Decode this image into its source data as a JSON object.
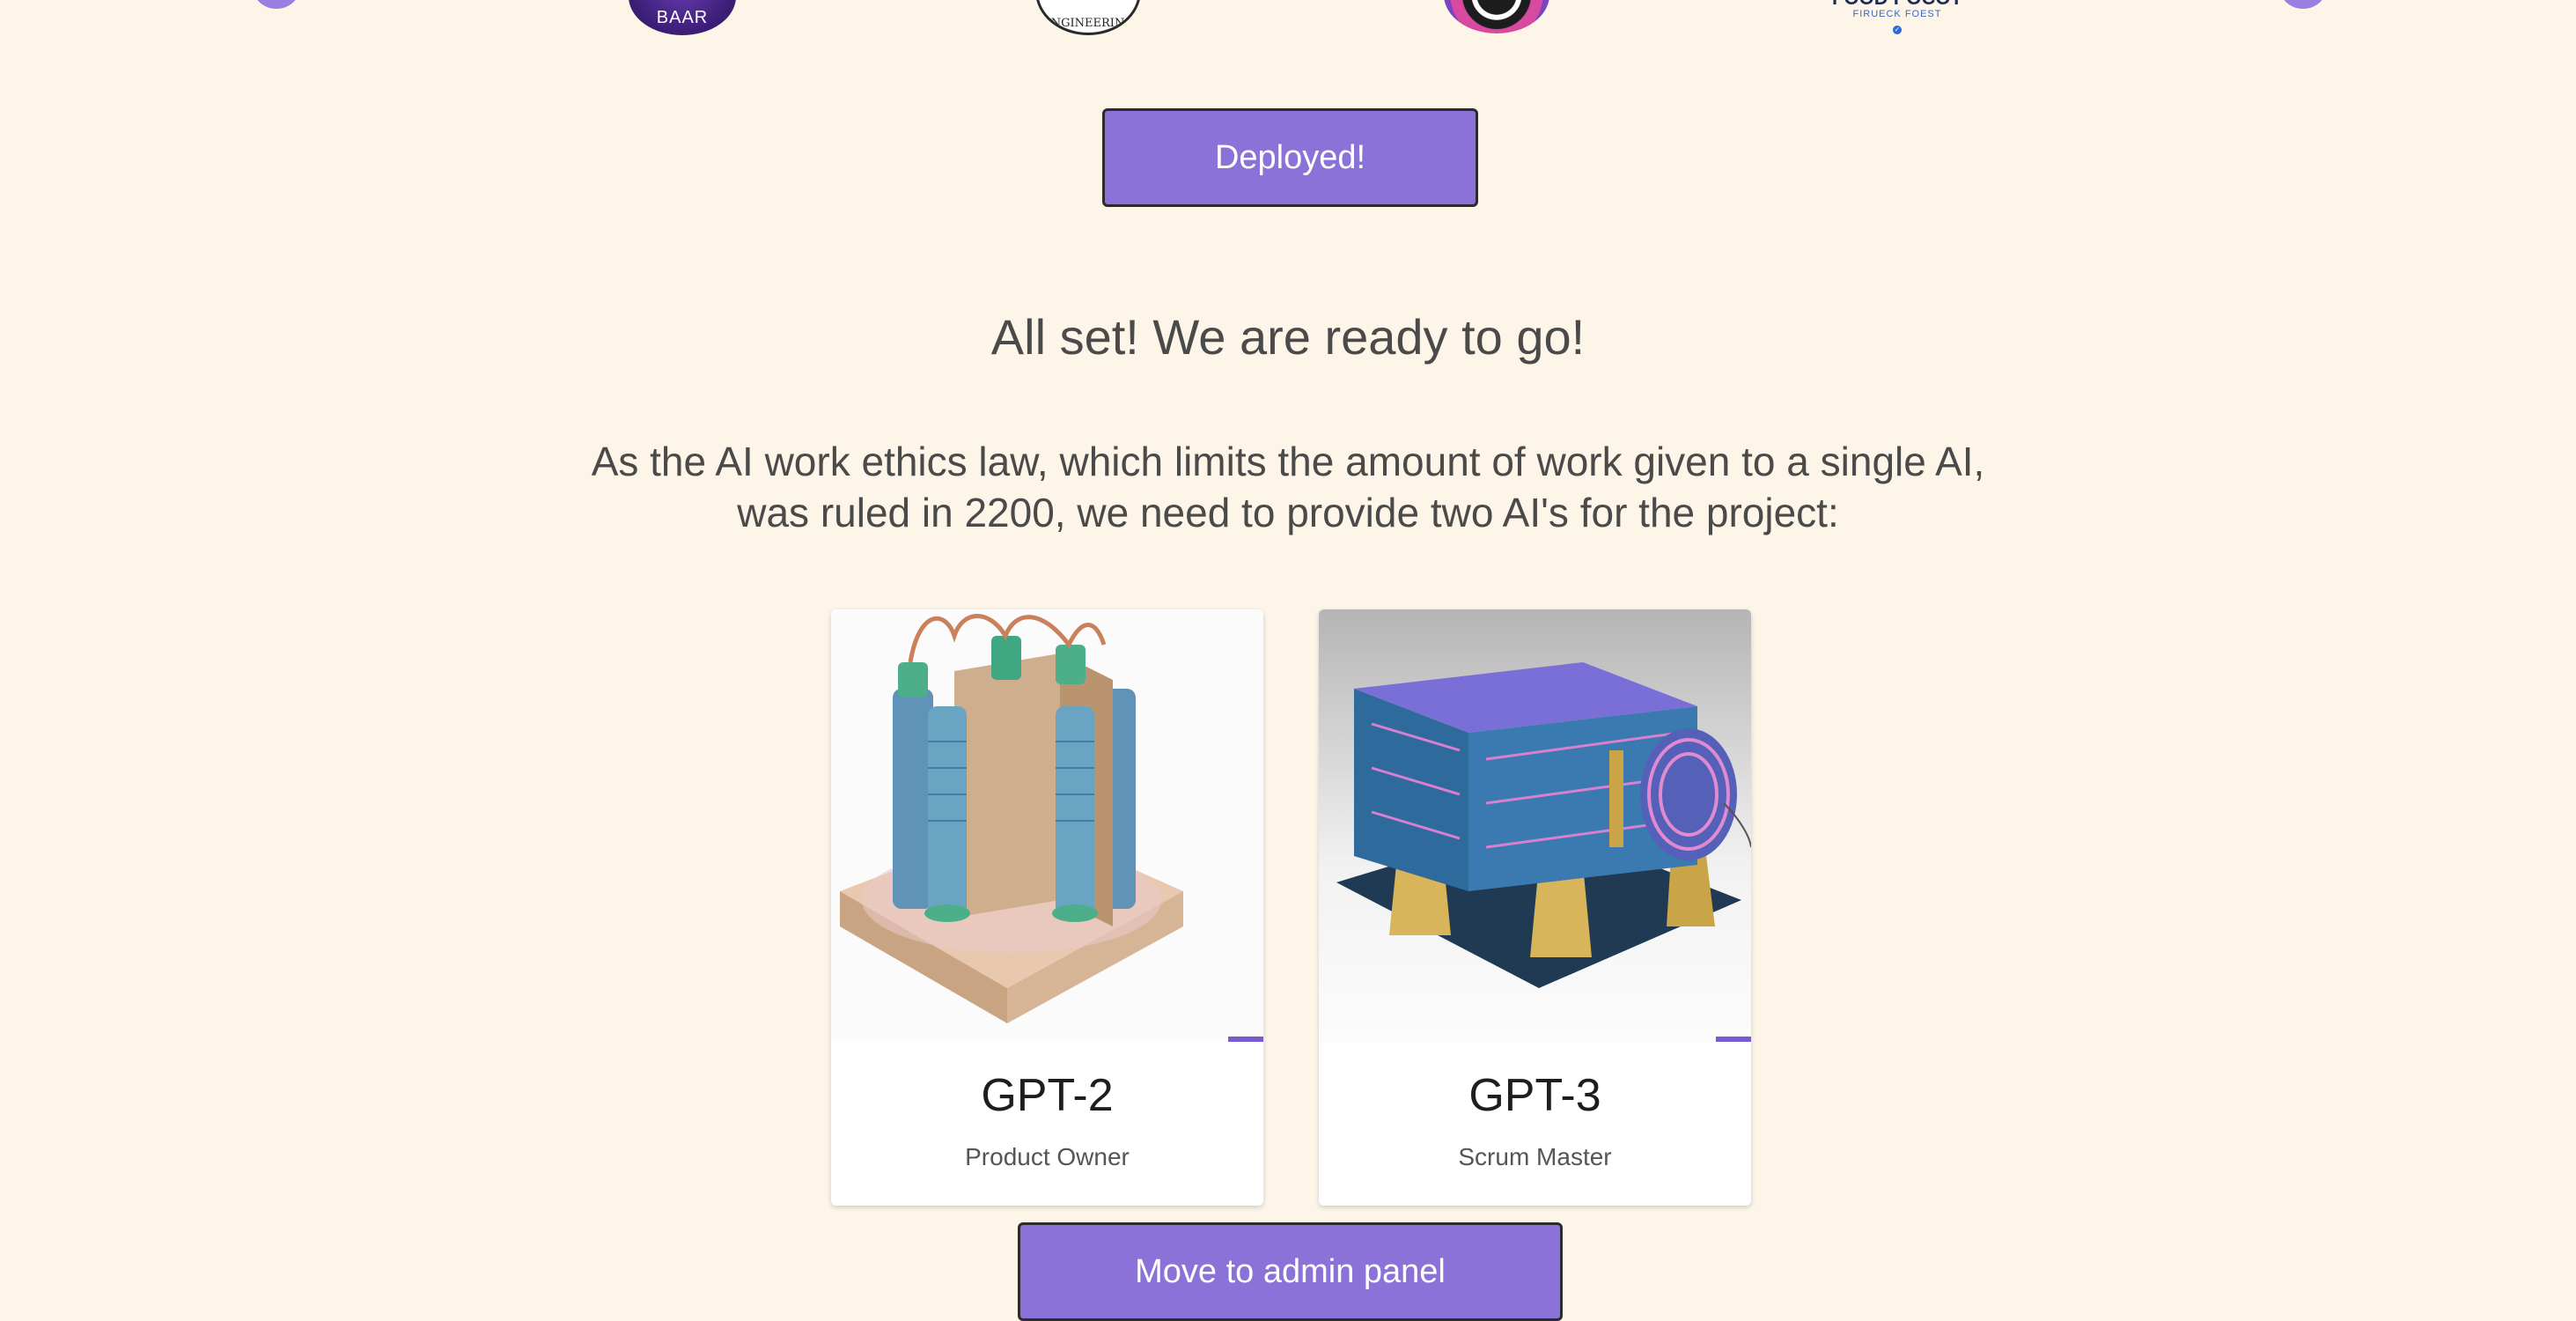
{
  "logos": [
    {
      "name": "baar-logo",
      "text": "BAAR"
    },
    {
      "name": "engineering-logo",
      "text": "ENGINEERING"
    },
    {
      "name": "ring-logo",
      "text": ""
    },
    {
      "name": "food-logo",
      "text": "FOOD POCOT",
      "subtext": "FIRUECK FOEST"
    }
  ],
  "deploy_button": {
    "label": "Deployed!"
  },
  "heading": "All set! We are ready to go!",
  "description_line1": "As the AI work ethics law, which limits the amount of work given to a single AI,",
  "description_line2": "was ruled in 2200, we need to provide two AI's for the project:",
  "cards": [
    {
      "title": "GPT-2",
      "role": "Product Owner",
      "image": "gpt2-machine-image"
    },
    {
      "title": "GPT-3",
      "role": "Scrum Master",
      "image": "gpt3-machine-image"
    }
  ],
  "admin_button": {
    "label": "Move to admin panel"
  },
  "colors": {
    "background": "#fdf6e8",
    "accent": "#8a72d8",
    "text": "#4a4a4a"
  }
}
